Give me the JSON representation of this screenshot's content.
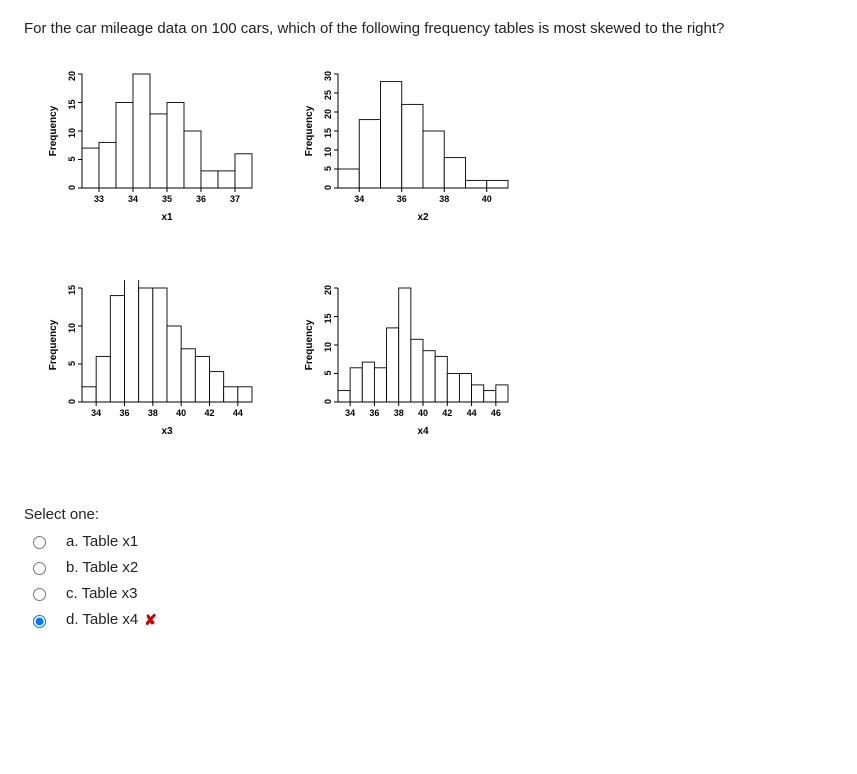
{
  "question": "For the car mileage data on 100 cars, which of the following frequency tables is most skewed to the right?",
  "select_prompt": "Select one:",
  "options": {
    "a": "a. Table x1",
    "b": "b. Table x2",
    "c": "c. Table x3",
    "d": "d. Table x4"
  },
  "wrong_mark": "✘",
  "chart_data": [
    {
      "type": "bar",
      "name": "x1",
      "xlabel": "x1",
      "ylabel": "Frequency",
      "y_ticks": [
        0,
        5,
        10,
        15,
        20
      ],
      "x_ticks": [
        33,
        34,
        35,
        36,
        37
      ],
      "bins": [
        32.5,
        33.0,
        33.5,
        34.0,
        34.5,
        35.0,
        35.5,
        36.0,
        36.5,
        37.0,
        37.5
      ],
      "values": [
        7,
        8,
        15,
        20,
        13,
        15,
        10,
        3,
        3,
        6
      ]
    },
    {
      "type": "bar",
      "name": "x2",
      "xlabel": "x2",
      "ylabel": "Frequency",
      "y_ticks": [
        0,
        5,
        10,
        15,
        20,
        25,
        30
      ],
      "x_ticks": [
        34,
        36,
        38,
        40
      ],
      "bins": [
        33,
        34,
        35,
        36,
        37,
        38,
        39,
        40,
        41
      ],
      "values": [
        5,
        18,
        28,
        22,
        15,
        8,
        2,
        2
      ]
    },
    {
      "type": "bar",
      "name": "x3",
      "xlabel": "x3",
      "ylabel": "Frequency",
      "y_ticks": [
        0,
        5,
        10,
        15
      ],
      "x_ticks": [
        34,
        36,
        38,
        40,
        42,
        44
      ],
      "bins": [
        33,
        34,
        35,
        36,
        37,
        38,
        39,
        40,
        41,
        42,
        43,
        44,
        45
      ],
      "values": [
        2,
        6,
        14,
        17,
        15,
        15,
        10,
        7,
        6,
        4,
        2,
        2
      ]
    },
    {
      "type": "bar",
      "name": "x4",
      "xlabel": "x4",
      "ylabel": "Frequency",
      "y_ticks": [
        0,
        5,
        10,
        15,
        20
      ],
      "x_ticks": [
        34,
        36,
        38,
        40,
        42,
        44,
        46
      ],
      "bins": [
        33,
        34,
        35,
        36,
        37,
        38,
        39,
        40,
        41,
        42,
        43,
        44,
        45,
        46,
        47
      ],
      "values": [
        2,
        6,
        7,
        6,
        13,
        20,
        11,
        9,
        8,
        5,
        5,
        3,
        2,
        3
      ]
    }
  ]
}
